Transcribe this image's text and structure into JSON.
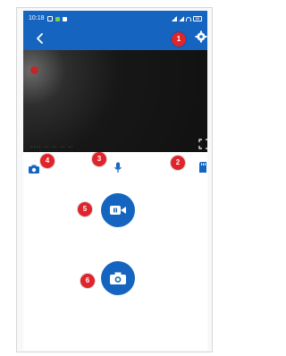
{
  "colors": {
    "header": "#1565c0",
    "accent": "#1565c0",
    "badge": "#e0242b"
  },
  "status_bar": {
    "time": "10:18",
    "battery": "88"
  },
  "icons": {
    "back": "chevron-left-icon",
    "settings": "gear-icon",
    "fullscreen": "fullscreen-icon",
    "snapshot": "camera-icon",
    "talk": "microphone-icon",
    "storage": "sd-card-icon",
    "record": "video-camera-icon",
    "capture": "camera-icon"
  },
  "badges": {
    "settings": "1",
    "storage": "2",
    "talk": "3",
    "snapshot": "4",
    "record": "5",
    "capture": "6"
  }
}
